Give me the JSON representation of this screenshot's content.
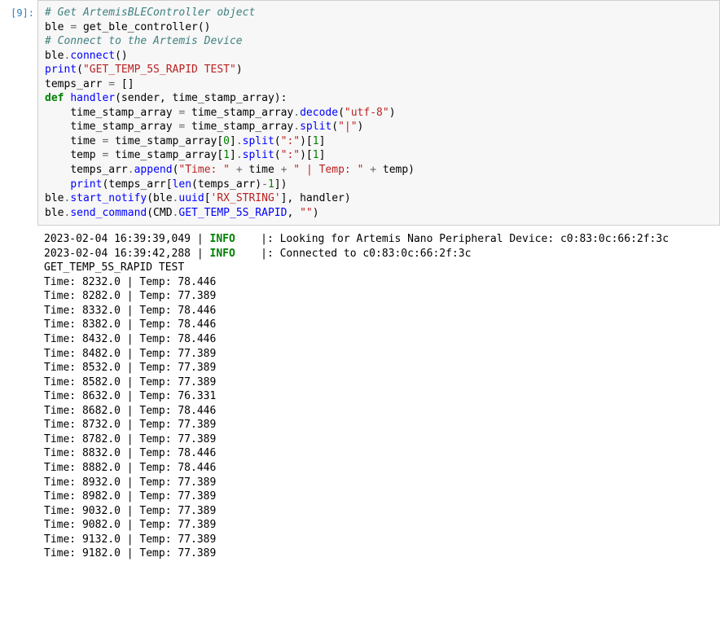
{
  "cell": {
    "prompt": "[9]:",
    "code": {
      "l1_comment": "# Get ArtemisBLEController object",
      "l2_a": "ble ",
      "l2_op": "=",
      "l2_b": " get_ble_controller()",
      "l3": "",
      "l4_comment": "# Connect to the Artemis Device",
      "l5_a": "ble",
      "l5_dot": ".",
      "l5_fn": "connect",
      "l5_p": "()",
      "l6": "",
      "l7_a": "print",
      "l7_p1": "(",
      "l7_s": "\"GET_TEMP_5S_RAPID TEST\"",
      "l7_p2": ")",
      "l8": "",
      "l9_a": "temps_arr ",
      "l9_op": "=",
      "l9_b": " []",
      "l10": "",
      "l11_kw": "def",
      "l11_sp": " ",
      "l11_name": "handler",
      "l11_sig": "(sender, time_stamp_array):",
      "l12_pad": "    ",
      "l12_a": "time_stamp_array ",
      "l12_op": "=",
      "l12_b": " time_stamp_array",
      "l12_dot": ".",
      "l12_fn": "decode",
      "l12_p1": "(",
      "l12_s": "\"utf-8\"",
      "l12_p2": ")",
      "l13_pad": "    ",
      "l13_a": "time_stamp_array ",
      "l13_op": "=",
      "l13_b": " time_stamp_array",
      "l13_dot": ".",
      "l13_fn": "split",
      "l13_p1": "(",
      "l13_s": "\"|\"",
      "l13_p2": ")",
      "l14_pad": "    ",
      "l14_a": "time ",
      "l14_op": "=",
      "l14_b": " time_stamp_array[",
      "l14_n1": "0",
      "l14_c": "]",
      "l14_dot": ".",
      "l14_fn": "split",
      "l14_p1": "(",
      "l14_s": "\":\"",
      "l14_p2": ")[",
      "l14_n2": "1",
      "l14_p3": "]",
      "l15_pad": "    ",
      "l15_a": "temp ",
      "l15_op": "=",
      "l15_b": " time_stamp_array[",
      "l15_n1": "1",
      "l15_c": "]",
      "l15_dot": ".",
      "l15_fn": "split",
      "l15_p1": "(",
      "l15_s": "\":\"",
      "l15_p2": ")[",
      "l15_n2": "1",
      "l15_p3": "]",
      "l16_pad": "    ",
      "l16_a": "temps_arr",
      "l16_dot": ".",
      "l16_fn": "append",
      "l16_p1": "(",
      "l16_s1": "\"Time: \"",
      "l16_sp1": " ",
      "l16_op1": "+",
      "l16_b": " time ",
      "l16_op2": "+",
      "l16_sp2": " ",
      "l16_s2": "\" | Temp: \"",
      "l16_sp3": " ",
      "l16_op3": "+",
      "l16_c": " temp)",
      "l17_pad": "    ",
      "l17_a": "print",
      "l17_p1": "(temps_arr[",
      "l17_fn": "len",
      "l17_p2": "(temps_arr)",
      "l17_op": "-",
      "l17_n": "1",
      "l17_p3": "])",
      "l18": "",
      "l19_a": "ble",
      "l19_dot1": ".",
      "l19_fn": "start_notify",
      "l19_p1": "(ble",
      "l19_dot2": ".",
      "l19_attr": "uuid",
      "l19_b": "[",
      "l19_s": "'RX_STRING'",
      "l19_c": "], handler)",
      "l20": "",
      "l21_a": "ble",
      "l21_dot1": ".",
      "l21_fn": "send_command",
      "l21_p1": "(CMD",
      "l21_dot2": ".",
      "l21_attr": "GET_TEMP_5S_RAPID",
      "l21_c": ", ",
      "l21_s": "\"\"",
      "l21_p2": ")"
    },
    "output": {
      "log1_a": "2023-02-04 16:39:39,049 | ",
      "log1_info": "INFO",
      "log1_b": "    |: Looking for Artemis Nano Peripheral Device: c0:83:0c:66:2f:3c",
      "log2_a": "2023-02-04 16:39:42,288 | ",
      "log2_info": "INFO",
      "log2_b": "    |: Connected to c0:83:0c:66:2f:3c",
      "hdr": "GET_TEMP_5S_RAPID TEST",
      "rows": [
        "Time: 8232.0 | Temp: 78.446",
        "Time: 8282.0 | Temp: 77.389",
        "Time: 8332.0 | Temp: 78.446",
        "Time: 8382.0 | Temp: 78.446",
        "Time: 8432.0 | Temp: 78.446",
        "Time: 8482.0 | Temp: 77.389",
        "Time: 8532.0 | Temp: 77.389",
        "Time: 8582.0 | Temp: 77.389",
        "Time: 8632.0 | Temp: 76.331",
        "Time: 8682.0 | Temp: 78.446",
        "Time: 8732.0 | Temp: 77.389",
        "Time: 8782.0 | Temp: 77.389",
        "Time: 8832.0 | Temp: 78.446",
        "Time: 8882.0 | Temp: 78.446",
        "Time: 8932.0 | Temp: 77.389",
        "Time: 8982.0 | Temp: 77.389",
        "Time: 9032.0 | Temp: 77.389",
        "Time: 9082.0 | Temp: 77.389",
        "Time: 9132.0 | Temp: 77.389",
        "Time: 9182.0 | Temp: 77.389"
      ]
    }
  }
}
